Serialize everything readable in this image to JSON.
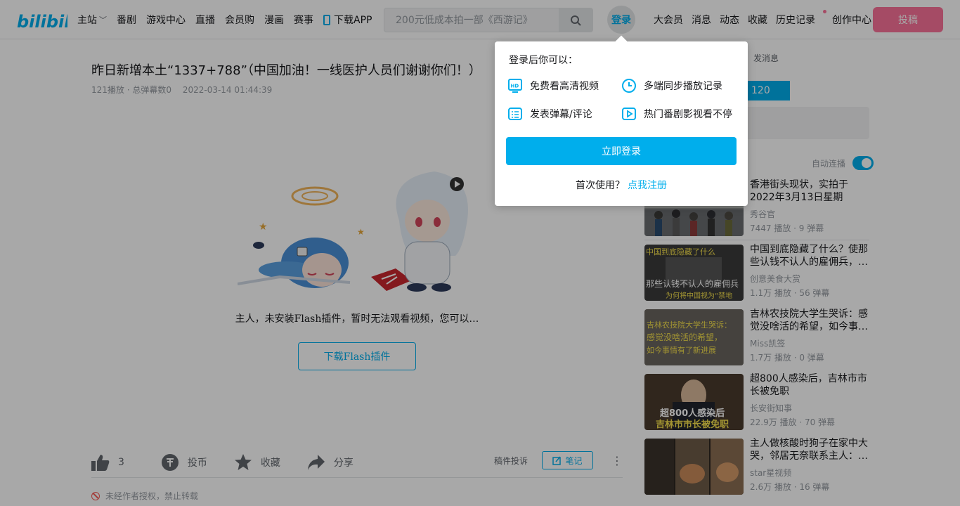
{
  "header": {
    "logo_text": "bilibili",
    "nav": [
      {
        "label": "主站",
        "has_chevron": true
      },
      {
        "label": "番剧"
      },
      {
        "label": "游戏中心"
      },
      {
        "label": "直播"
      },
      {
        "label": "会员购"
      },
      {
        "label": "漫画"
      },
      {
        "label": "赛事"
      },
      {
        "label": "下载APP",
        "icon": "phone-icon"
      }
    ],
    "search_placeholder": "200元低成本拍一部《西游记》",
    "login_label": "登录",
    "right_nav": [
      "大会员",
      "消息",
      "动态",
      "收藏",
      "历史记录",
      "创作中心"
    ],
    "upload_label": "投稿",
    "accent": "#00aeec",
    "brand_pink": "#fb7299"
  },
  "video": {
    "title": "昨日新增本土“1337+788”（中国加油！一线医护人员们谢谢你们！）",
    "views": "121播放",
    "separator": " · ",
    "danmaku": "总弹幕数0",
    "date": "2022-03-14 01:44:39",
    "flash_message": "主人，未安装Flash插件，暂时无法观看视频，您可以…",
    "flash_button": "下载Flash插件"
  },
  "toolbar": {
    "like_count": "3",
    "coin_label": "投币",
    "fav_label": "收藏",
    "share_label": "分享",
    "report_label": "稿件投诉",
    "note_label": "笔记",
    "more_label": "⋮",
    "copyright": "未经作者授权，禁止转载"
  },
  "sidebar": {
    "message_label": "发消息",
    "blue_value": "120",
    "autoplay_label": "自动连播",
    "autoplay_on": true
  },
  "recommendations": [
    {
      "title": "香港街头现状，实拍于2022年3月13日星期日，…",
      "up": "秀谷官",
      "stats": "7447 播放 · 9 弹幕"
    },
    {
      "title": "中国到底隐藏了什么？使那些认钱不认人的雇佣兵，…",
      "up": "创意美食大赏",
      "stats": "1.1万 播放 · 56 弹幕",
      "thumb_text_top": "中国到底隐藏了什么",
      "thumb_text_bottom": "那些认钱不认人的雇佣兵",
      "thumb_text_sub": "为何将中国视为“禁地"
    },
    {
      "title": "吉林农技院大学生哭诉：感觉没啥活的希望，如今事…",
      "up": "Miss凯签",
      "stats": "1.7万 播放 · 0 弹幕",
      "thumb_text_top": "吉林农技院大学生哭诉：",
      "thumb_text_mid": "感觉没啥活的希望，",
      "thumb_text_bottom": "如今事情有了新进展"
    },
    {
      "title": "超800人感染后，吉林市市长被免职",
      "up": "长安街知事",
      "stats": "22.9万 播放 · 70 弹幕",
      "thumb_text_top": "超800人感染后",
      "thumb_text_bottom": "吉林市市长被免职"
    },
    {
      "title": "主人做核酸时狗子在家中大哭，邻居无奈联系主人：…",
      "up": "star星视频",
      "stats": "2.6万 播放 · 16 弹幕"
    }
  ],
  "login_popup": {
    "heading": "登录后你可以：",
    "benefits": [
      {
        "label": "免费看高清视频",
        "icon": "hd-icon"
      },
      {
        "label": "多端同步播放记录",
        "icon": "clock-icon"
      },
      {
        "label": "发表弹幕/评论",
        "icon": "comment-icon"
      },
      {
        "label": "热门番剧影视看不停",
        "icon": "play-icon"
      }
    ],
    "login_button": "立即登录",
    "register_prompt": "首次使用？",
    "register_link": "点我注册"
  }
}
